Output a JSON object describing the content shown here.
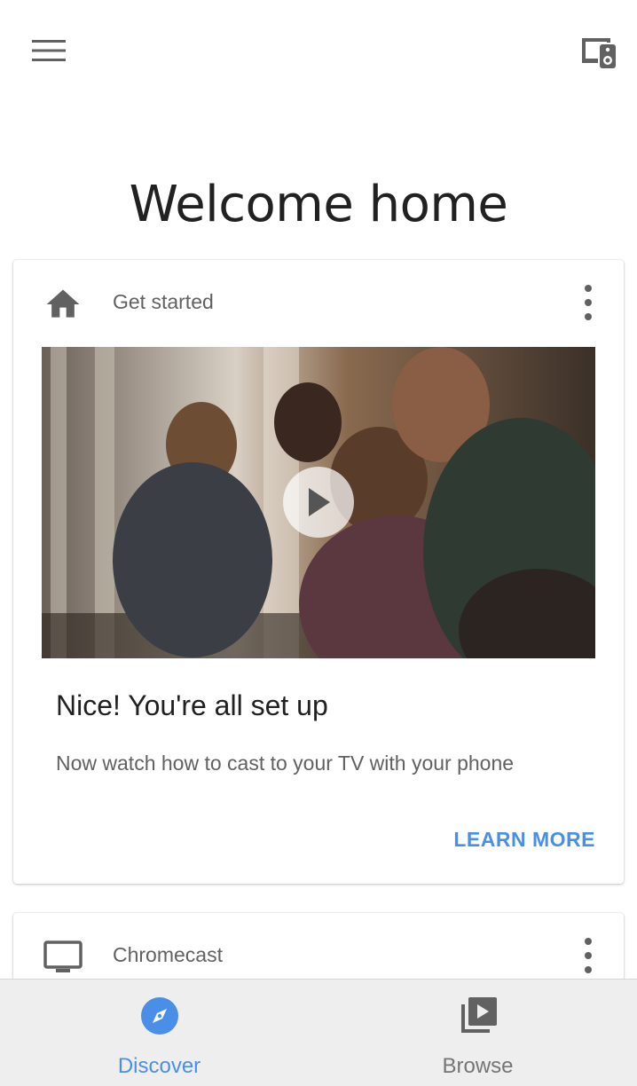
{
  "header": {
    "menu_icon": "hamburger-menu-icon",
    "devices_icon": "devices-speaker-icon",
    "title": "Welcome home"
  },
  "cards": [
    {
      "header_icon": "home-icon",
      "header_label": "Get started",
      "overflow_icon": "more-vert-icon",
      "video_play_icon": "play-icon",
      "title": "Nice! You're all set up",
      "body": "Now watch how to cast to your TV with your phone",
      "action_label": "LEARN MORE"
    },
    {
      "header_icon": "tv-icon",
      "header_label": "Chromecast",
      "overflow_icon": "more-vert-icon"
    }
  ],
  "bottom_nav": {
    "items": [
      {
        "label": "Discover",
        "icon": "compass-icon",
        "active": true
      },
      {
        "label": "Browse",
        "icon": "video-library-icon",
        "active": false
      }
    ]
  },
  "colors": {
    "accent": "#4a8fe7",
    "icon_gray": "#616161",
    "nav_background": "#eeeeee"
  }
}
